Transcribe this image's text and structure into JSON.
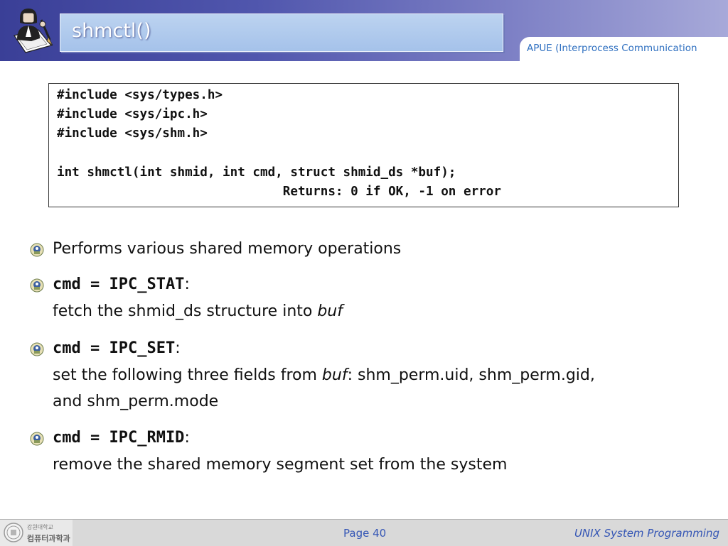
{
  "header": {
    "title": "shmctl()",
    "subtitle": "APUE (Interprocess Communication"
  },
  "code": {
    "lines": [
      "#include <sys/types.h>",
      "#include <sys/ipc.h>",
      "#include <sys/shm.h>",
      "",
      "int shmctl(int shmid, int cmd, struct shmid_ds *buf);",
      "                              Returns: 0 if OK, -1 on error"
    ]
  },
  "bullets": {
    "b1": {
      "text": "Performs various shared memory operations"
    },
    "b2": {
      "code": "cmd = IPC_STAT",
      "colon": ":",
      "desc_pre": "fetch the shmid_ds structure into ",
      "desc_em": "buf"
    },
    "b3": {
      "code": "cmd = IPC_SET",
      "colon": ":",
      "desc_pre": "set the following three fields from ",
      "desc_em": "buf",
      "desc_post": ": shm_perm.uid, shm_perm.gid,",
      "desc_line2": "and shm_perm.mode"
    },
    "b4": {
      "code": "cmd = IPC_RMID",
      "colon": ":",
      "desc": "remove the shared memory segment set from the system"
    }
  },
  "footer": {
    "university": "강원대학교",
    "department": "컴퓨터과학과",
    "page": "Page 40",
    "course": "UNIX System Programming"
  },
  "colors": {
    "header_gradient_start": "#3a3f97",
    "title_box": "#a5c2ea",
    "subtitle_text": "#2e6fc0",
    "footer_text": "#3556b5",
    "footer_bg": "#d9d9d9"
  },
  "icons": {
    "header_logo": "man-with-pen-logo",
    "bullet": "university-emblem-bullet-icon",
    "footer_logo": "university-seal-icon"
  }
}
